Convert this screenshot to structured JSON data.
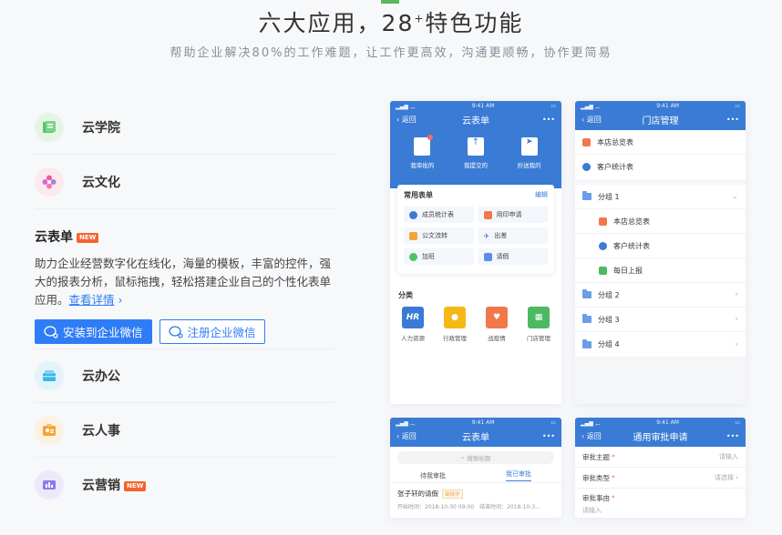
{
  "hero": {
    "title_main": "六大应用，28",
    "title_sup": "+",
    "title_tail": "特色功能",
    "subtitle": "帮助企业解决80%的工作难题，让工作更高效，沟通更顺畅，协作更简易"
  },
  "features": {
    "academy": "云学院",
    "culture": "云文化",
    "office": "云办公",
    "hr": "云人事",
    "marketing": "云营销",
    "new_badge": "NEW"
  },
  "expanded": {
    "title": "云表单",
    "badge": "NEW",
    "description": "助力企业经营数字化在线化，海量的模板，丰富的控件，强大的报表分析，鼠标拖拽，轻松搭建企业自己的个性化表单应用。",
    "link": "查看详情",
    "install_button": "安装到企业微信",
    "register_button": "注册企业微信"
  },
  "phone1": {
    "time": "9:41 AM",
    "back": "返回",
    "title": "云表单",
    "more": "•••",
    "actions": [
      "我审批的",
      "我提交的",
      "抄送我的"
    ],
    "common_title": "常用表单",
    "edit": "编辑",
    "forms": [
      "成员统计表",
      "用印申请",
      "公文流转",
      "出差",
      "加班",
      "请假"
    ],
    "category_title": "分类",
    "categories": [
      "人力资源",
      "行政管理",
      "战疫情",
      "门店管理"
    ],
    "hr_icon": "HR"
  },
  "phone2": {
    "time": "9:41 AM",
    "back": "返回",
    "title": "门店管理",
    "more": "•••",
    "top_items": [
      "本店总览表",
      "客户统计表"
    ],
    "group1": "分组 1",
    "group1_items": [
      "本店总览表",
      "客户统计表",
      "每日上报"
    ],
    "groups": [
      "分组 2",
      "分组 3",
      "分组 4"
    ]
  },
  "phone3": {
    "time": "9:41 AM",
    "back": "返回",
    "title": "云表单",
    "more": "•••",
    "search_placeholder": "搜索标题",
    "tab_pending": "待我审批",
    "tab_done": "我已审批",
    "entry_title": "张子轩的请假",
    "entry_status": "审批中",
    "entry_start": "开始时间：2018-10-30 09:00",
    "entry_end": "结束时间：2018-10-3..."
  },
  "phone4": {
    "time": "9:41 AM",
    "back": "返回",
    "title": "通用审批申请",
    "more": "•••",
    "field_subject": "审批主题",
    "field_type": "审批类型",
    "field_reason": "审批事由",
    "ph_input": "请输入",
    "ph_select": "请选择",
    "ph_input_bottom": "请输入"
  },
  "colors": {
    "brand_blue": "#2e7df6",
    "header_blue": "#3a7bd5",
    "badge_orange": "#f5632e"
  }
}
